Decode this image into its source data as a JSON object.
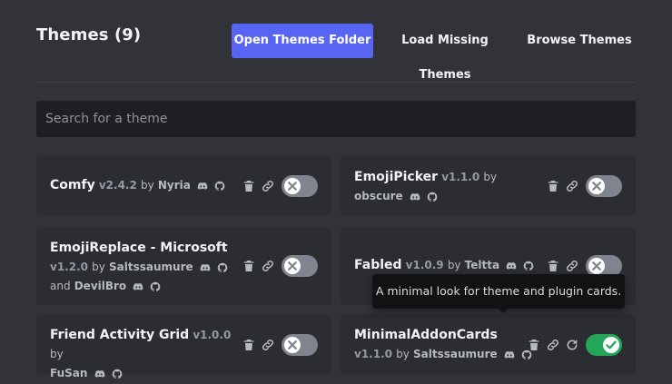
{
  "header": {
    "title": "Themes (9)",
    "open_folder": "Open Themes Folder",
    "load_missing": "Load Missing Themes",
    "browse": "Browse Themes"
  },
  "search": {
    "placeholder": "Search for a theme"
  },
  "colors": {
    "accent": "#5865f2",
    "toggle_on": "#23a55a",
    "toggle_off": "#80848e"
  },
  "themes": [
    {
      "name": "Comfy",
      "version": "v2.4.2",
      "by": "by",
      "author": "Nyria",
      "enabled": false
    },
    {
      "name": "EmojiPicker",
      "version": "v1.1.0",
      "by": "by",
      "author": "obscure",
      "enabled": false
    },
    {
      "name": "EmojiReplace - Microsoft",
      "version": "v1.2.0",
      "by": "by",
      "author": "Saltssaumure",
      "and": "and",
      "author2": "DevilBro",
      "enabled": false
    },
    {
      "name": "Fabled",
      "version": "v1.0.9",
      "by": "by",
      "author": "Teltta",
      "enabled": false
    },
    {
      "name": "Friend Activity Grid",
      "version": "v1.0.0",
      "by": "by",
      "author": "FuSan",
      "enabled": false
    },
    {
      "name": "MinimalAddonCards",
      "version": "v1.1.0",
      "by": "by",
      "author": "Saltssaumure",
      "enabled": true
    }
  ],
  "tooltip": {
    "text": "A minimal look for theme and plugin cards."
  },
  "icons": [
    "discord-icon",
    "github-icon",
    "trash-icon",
    "link-icon",
    "reload-icon",
    "x-icon",
    "check-icon"
  ]
}
